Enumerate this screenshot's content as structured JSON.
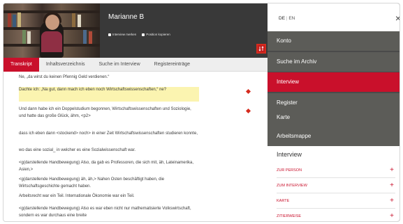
{
  "header": {
    "interviewee": "Marianne B",
    "actions": [
      {
        "label": "Interview merken",
        "icon": "bookmark-icon"
      },
      {
        "label": "Position kopieren",
        "icon": "copy-icon"
      }
    ]
  },
  "tabs": [
    {
      "label": "Transkript",
      "active": true
    },
    {
      "label": "Inhaltsverzeichnis",
      "active": false
    },
    {
      "label": "Suche im Interview",
      "active": false
    },
    {
      "label": "Registereinträge",
      "active": false
    }
  ],
  "transcript": {
    "paragraphs": [
      "Ne, „da wirst du keinen Pfennig Geld verdienen.“",
      "Dachte ich: „Na gut, dann mach ich eben noch Wirtschaftswissenschaften,“ ne?",
      "Und dann habe ich ein Doppelstudium begonnen, Wirtschaftswissenschaften und Soziologie, und hatte das große Glück, ähm, <p2>",
      "dass ich eben dann <stockend> noch> in einer Zeit Wirtschaftswissenschaften studieren konnte,",
      "wo das eine sozial_ in welcher es eine Sozialwissenschaft war.",
      "<g(darstellende Handbewegung) Also, da gab es Professoren, die sich mit, äh, Lateinamerika, Asien,>",
      "<g(darstellende Handbewegung) äh, äh,> Nahen Osten beschäftigt haben, die Wirtschaftsgeschichte gemacht haben.",
      "Arbeitsrecht war ein Teil. Internationale Ökonomie war ein Teil.",
      "<g(darstellende Handbewegung) Also es war eben nicht nur mathematisierte Volkswirtschaft, sondern es war durchaus eine breite"
    ],
    "highlighted_index": 1
  },
  "panel": {
    "languages": [
      "DE",
      "EN"
    ],
    "close_symbol": "×",
    "nav": [
      {
        "label": "Konto",
        "active": false
      },
      {
        "label": "Suche im Archiv",
        "active": false
      },
      {
        "label": "Interview",
        "active": true
      },
      {
        "label": "Register",
        "active": false
      },
      {
        "label": "Karte",
        "active": false
      },
      {
        "label": "Arbeitsmappe",
        "active": false
      }
    ],
    "section_title": "Interview",
    "accordion": [
      {
        "label": "ZUR PERSON"
      },
      {
        "label": "ZUM INTERVIEW"
      },
      {
        "label": "KARTE"
      },
      {
        "label": "ZITIERWEISE"
      }
    ]
  },
  "colors": {
    "accent": "#c9102b",
    "header_bg": "#393939",
    "panel_bg": "#5c5c58",
    "highlight": "#fbf4b0"
  }
}
